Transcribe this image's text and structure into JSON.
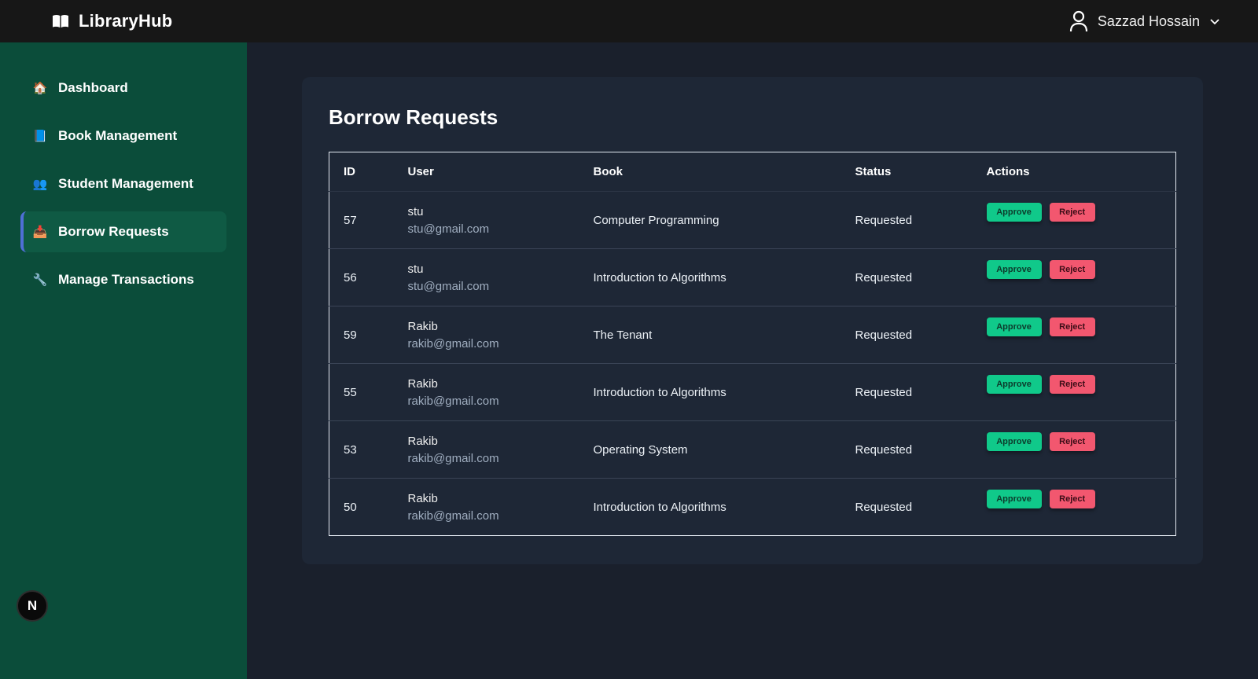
{
  "app": {
    "brand": "LibraryHub",
    "user_name": "Sazzad Hossain",
    "badge_letter": "N"
  },
  "colors": {
    "topbar_bg": "#171717",
    "sidebar_bg": "#0b4d3a",
    "main_bg": "#1a202c",
    "card_bg": "#1e2736",
    "approve": "#10c98a",
    "reject": "#f2576f",
    "active_accent": "#4f6fd6"
  },
  "sidebar": {
    "items": [
      {
        "label": "Dashboard",
        "icon": "house-icon",
        "glyph": "🏠"
      },
      {
        "label": "Book Management",
        "icon": "book-icon",
        "glyph": "📘"
      },
      {
        "label": "Student Management",
        "icon": "users-icon",
        "glyph": "👥"
      },
      {
        "label": "Borrow Requests",
        "icon": "inbox-tray-icon",
        "glyph": "📥",
        "active": true
      },
      {
        "label": "Manage Transactions",
        "icon": "wrench-icon",
        "glyph": "🔧"
      }
    ]
  },
  "main": {
    "title": "Borrow Requests",
    "columns": [
      "ID",
      "User",
      "Book",
      "Status",
      "Actions"
    ],
    "approve_label": "Approve",
    "reject_label": "Reject",
    "rows": [
      {
        "id": "57",
        "user": "stu",
        "email": "stu@gmail.com",
        "book": "Computer Programming",
        "status": "Requested"
      },
      {
        "id": "56",
        "user": "stu",
        "email": "stu@gmail.com",
        "book": "Introduction to Algorithms",
        "status": "Requested"
      },
      {
        "id": "59",
        "user": "Rakib",
        "email": "rakib@gmail.com",
        "book": "The Tenant",
        "status": "Requested"
      },
      {
        "id": "55",
        "user": "Rakib",
        "email": "rakib@gmail.com",
        "book": "Introduction to Algorithms",
        "status": "Requested"
      },
      {
        "id": "53",
        "user": "Rakib",
        "email": "rakib@gmail.com",
        "book": "Operating System",
        "status": "Requested"
      },
      {
        "id": "50",
        "user": "Rakib",
        "email": "rakib@gmail.com",
        "book": "Introduction to Algorithms",
        "status": "Requested"
      }
    ]
  }
}
